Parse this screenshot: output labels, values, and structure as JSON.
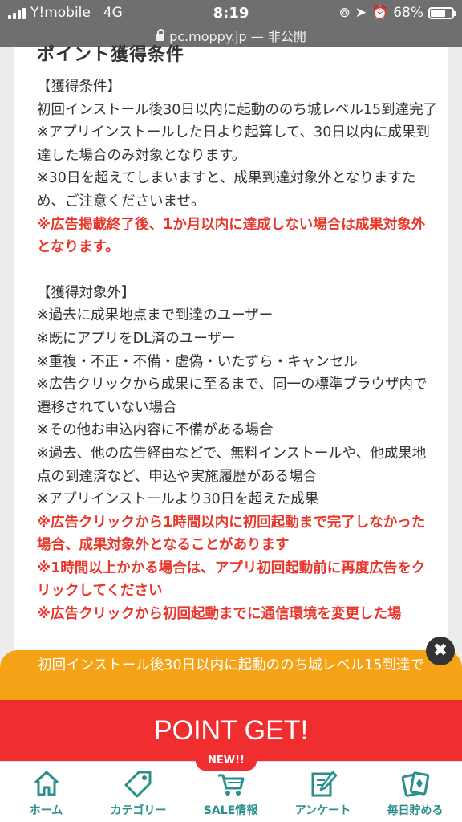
{
  "status_bar": {
    "carrier": "Y!mobile",
    "network": "4G",
    "time": "8:19",
    "battery": "68%",
    "battery_level": 0.68
  },
  "url_bar": {
    "domain": "pc.moppy.jp",
    "suffix": "— 非公開"
  },
  "section_title": "ポイント獲得条件",
  "lines": [
    {
      "text": "【獲得条件】",
      "style": "normal"
    },
    {
      "text": "初回インストール後30日以内に起動ののち城レベル15到達完了",
      "style": "normal"
    },
    {
      "text": "※アプリインストールした日より起算して、30日以内に成果到達した場合のみ対象となります。",
      "style": "normal"
    },
    {
      "text": "※30日を超えてしまいますと、成果到達対象外となりますため、ご注意くださいませ。",
      "style": "normal"
    },
    {
      "text": "※広告掲載終了後、1か月以内に達成しない場合は成果対象外となります。",
      "style": "red"
    },
    {
      "text": "",
      "style": "gap"
    },
    {
      "text": "【獲得対象外】",
      "style": "normal"
    },
    {
      "text": "※過去に成果地点まで到達のユーザー",
      "style": "normal"
    },
    {
      "text": "※既にアプリをDL済のユーザー",
      "style": "normal"
    },
    {
      "text": "※重複・不正・不備・虚偽・いたずら・キャンセル",
      "style": "normal"
    },
    {
      "text": "※広告クリックから成果に至るまで、同一の標準ブラウザ内で遷移されていない場合",
      "style": "normal"
    },
    {
      "text": "※その他お申込内容に不備がある場合",
      "style": "normal"
    },
    {
      "text": "※過去、他の広告経由などで、無料インストールや、他成果地点の到達済など、申込や実施履歴がある場合",
      "style": "normal"
    },
    {
      "text": "※アプリインストールより30日を超えた成果",
      "style": "normal"
    },
    {
      "text": "※広告クリックから1時間以内に初回起動まで完了しなかった場合、成果対象外となることがあります",
      "style": "red"
    },
    {
      "text": "※1時間以上かかる場合は、アプリ初回起動前に再度広告をクリックしてください",
      "style": "red"
    },
    {
      "text": "※広告クリックから初回起動までに通信環境を変更した場",
      "style": "red"
    }
  ],
  "banner": {
    "text": "初回インストール後30日以内に起動ののち城レベル15到達で",
    "close_glyph": "✖"
  },
  "cta": {
    "label": "POINT GET!"
  },
  "nav": {
    "badge": "NEW!!",
    "accent": "#2a8f8a",
    "items": [
      {
        "label": "ホーム",
        "icon": "home-icon"
      },
      {
        "label": "カテゴリー",
        "icon": "tag-icon"
      },
      {
        "label": "SALE情報",
        "icon": "cart-icon"
      },
      {
        "label": "アンケート",
        "icon": "survey-icon"
      },
      {
        "label": "毎日貯める",
        "icon": "cards-icon"
      }
    ]
  }
}
